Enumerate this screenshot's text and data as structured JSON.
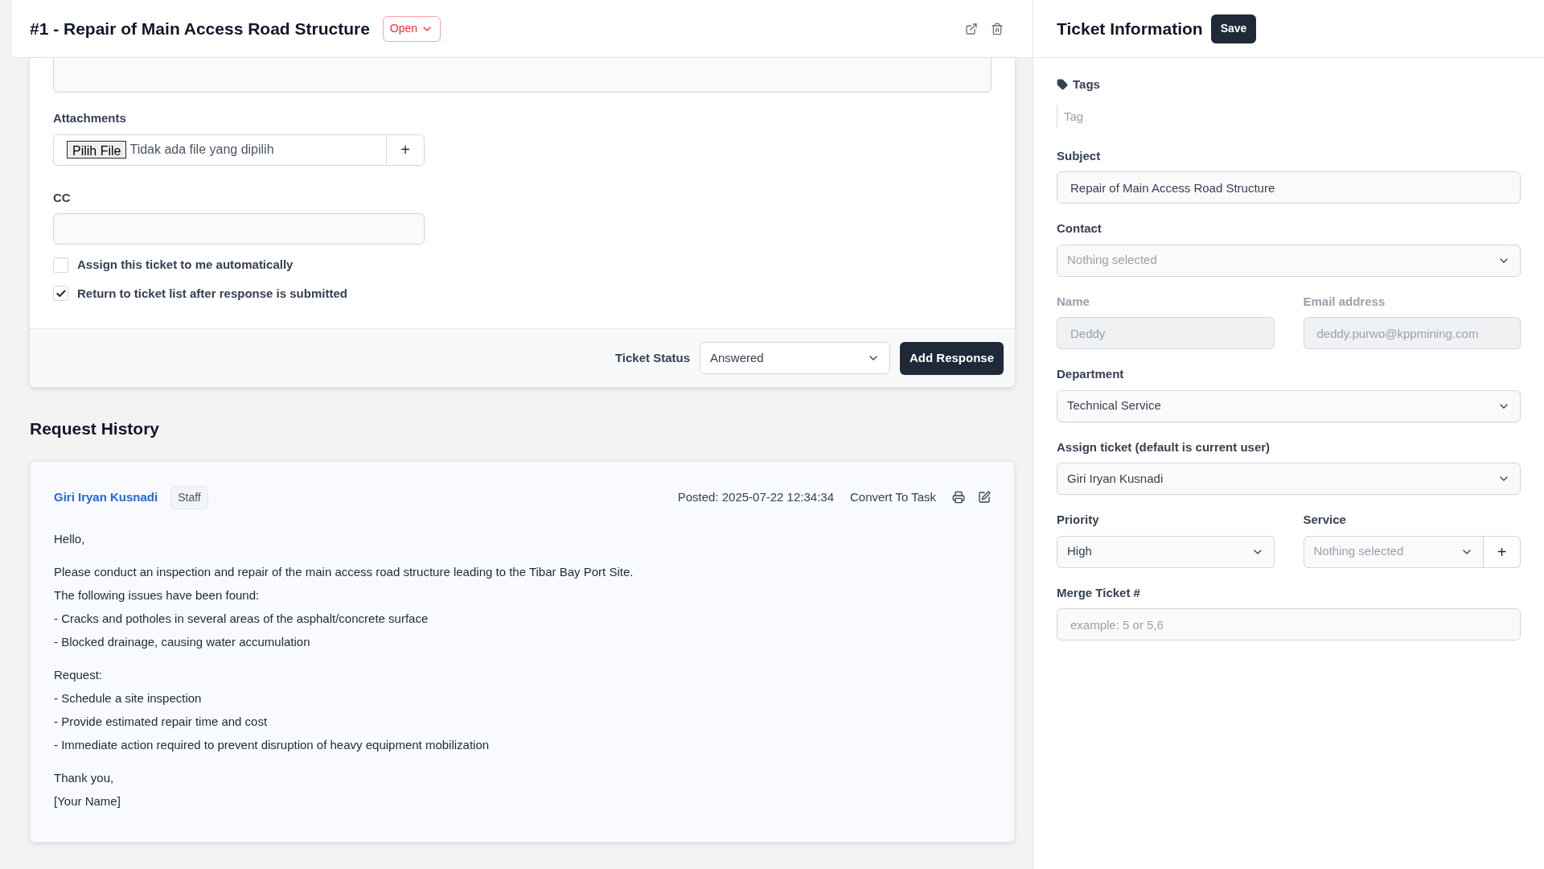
{
  "header": {
    "title": "#1 - Repair of Main Access Road Structure",
    "status": "Open"
  },
  "response_form": {
    "attachments_label": "Attachments",
    "file_button": "Pilih File",
    "file_status": "Tidak ada file yang dipilih",
    "add_symbol": "+",
    "cc_label": "CC",
    "checkboxes": [
      {
        "label": "Assign this ticket to me automatically",
        "checked": false
      },
      {
        "label": "Return to ticket list after response is submitted",
        "checked": true
      }
    ],
    "status_label": "Ticket Status",
    "status_value": "Answered",
    "submit": "Add Response"
  },
  "history": {
    "title": "Request History",
    "entries": [
      {
        "author": "Giri Iryan Kusnadi",
        "role": "Staff",
        "posted": "Posted: 2025-07-22 12:34:34",
        "convert": "Convert To Task",
        "paragraphs": [
          [
            "Hello,"
          ],
          [
            "Please conduct an inspection and repair of the main access road structure leading to the Tibar Bay Port Site.",
            "The following issues have been found:",
            "- Cracks and potholes in several areas of the asphalt/concrete surface",
            "- Blocked drainage, causing water accumulation"
          ],
          [
            "Request:",
            "- Schedule a site inspection",
            "- Provide estimated repair time and cost",
            "- Immediate action required to prevent disruption of heavy equipment mobilization"
          ],
          [
            "Thank you,",
            "[Your Name]"
          ]
        ]
      }
    ]
  },
  "sidebar": {
    "title": "Ticket Information",
    "save": "Save",
    "tags_label": "Tags",
    "tags_placeholder": "Tag",
    "fields": [
      {
        "kind": "input",
        "label": "Subject",
        "value": "Repair of Main Access Road Structure"
      },
      {
        "kind": "select",
        "label": "Contact",
        "placeholder": "Nothing selected"
      },
      {
        "kind": "pair",
        "items": [
          {
            "label": "Name",
            "value": "Deddy",
            "disabled": true
          },
          {
            "label": "Email address",
            "value": "deddy.purwo@kppmining.com",
            "disabled": true
          }
        ]
      },
      {
        "kind": "select",
        "label": "Department",
        "value": "Technical Service"
      },
      {
        "kind": "select",
        "label": "Assign ticket (default is current user)",
        "value": "Giri Iryan Kusnadi"
      },
      {
        "kind": "priority",
        "items": [
          {
            "label": "Priority",
            "value": "High"
          },
          {
            "label": "Service",
            "placeholder": "Nothing selected",
            "add": "+"
          }
        ]
      },
      {
        "kind": "input",
        "label": "Merge Ticket #",
        "placeholder": "example: 5 or 5,6"
      }
    ]
  }
}
